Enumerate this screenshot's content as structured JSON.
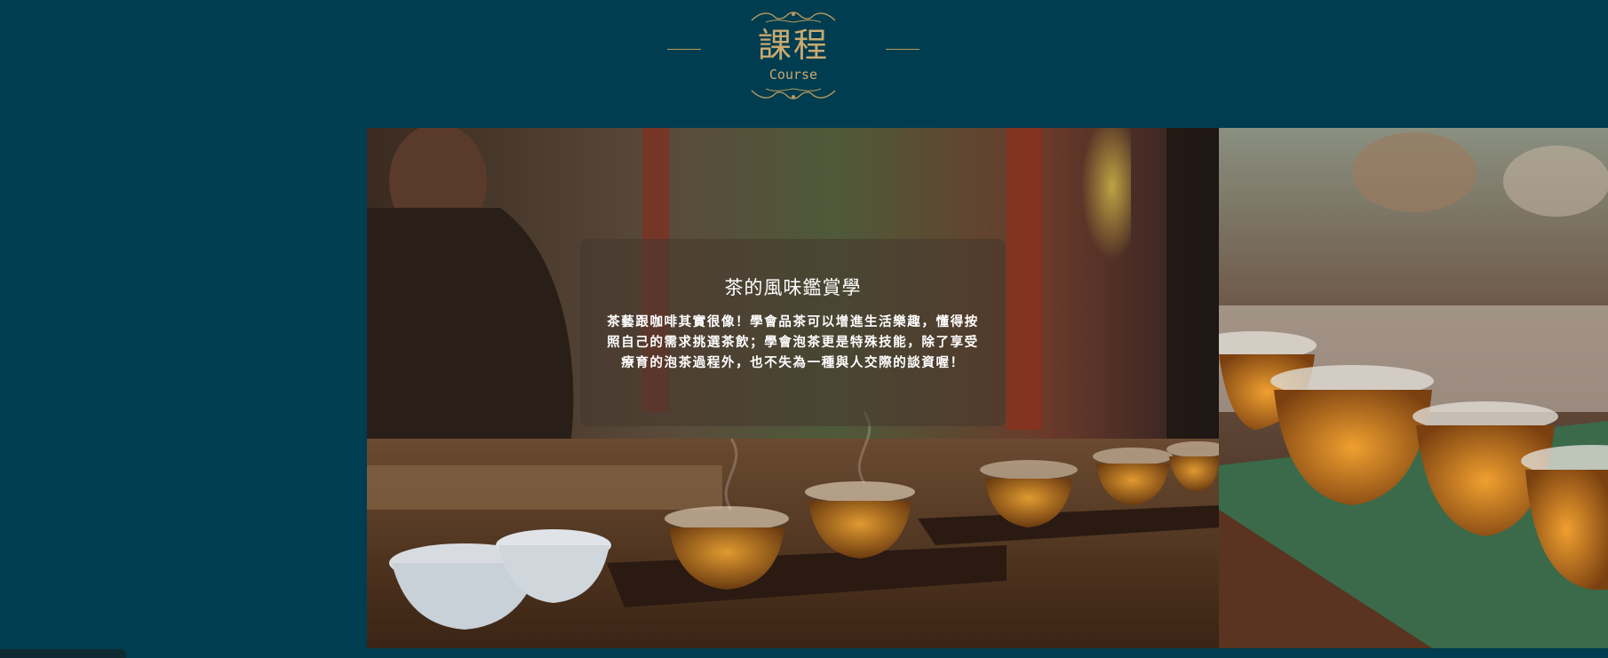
{
  "section": {
    "title_zh": "課程",
    "title_en": "Course"
  },
  "carousel": {
    "slides": [
      {
        "title": "茶的風味鑑賞學",
        "description": "茶藝跟咖啡其實很像！學會品茶可以增進生活樂趣，懂得按照自己的需求挑選茶飲；學會泡茶更是特殊技能，除了享受療育的泡茶過程外，也不失為一種與人交際的談資喔！"
      }
    ]
  },
  "colors": {
    "background": "#003d50",
    "accent_gold": "#c9aa70"
  }
}
